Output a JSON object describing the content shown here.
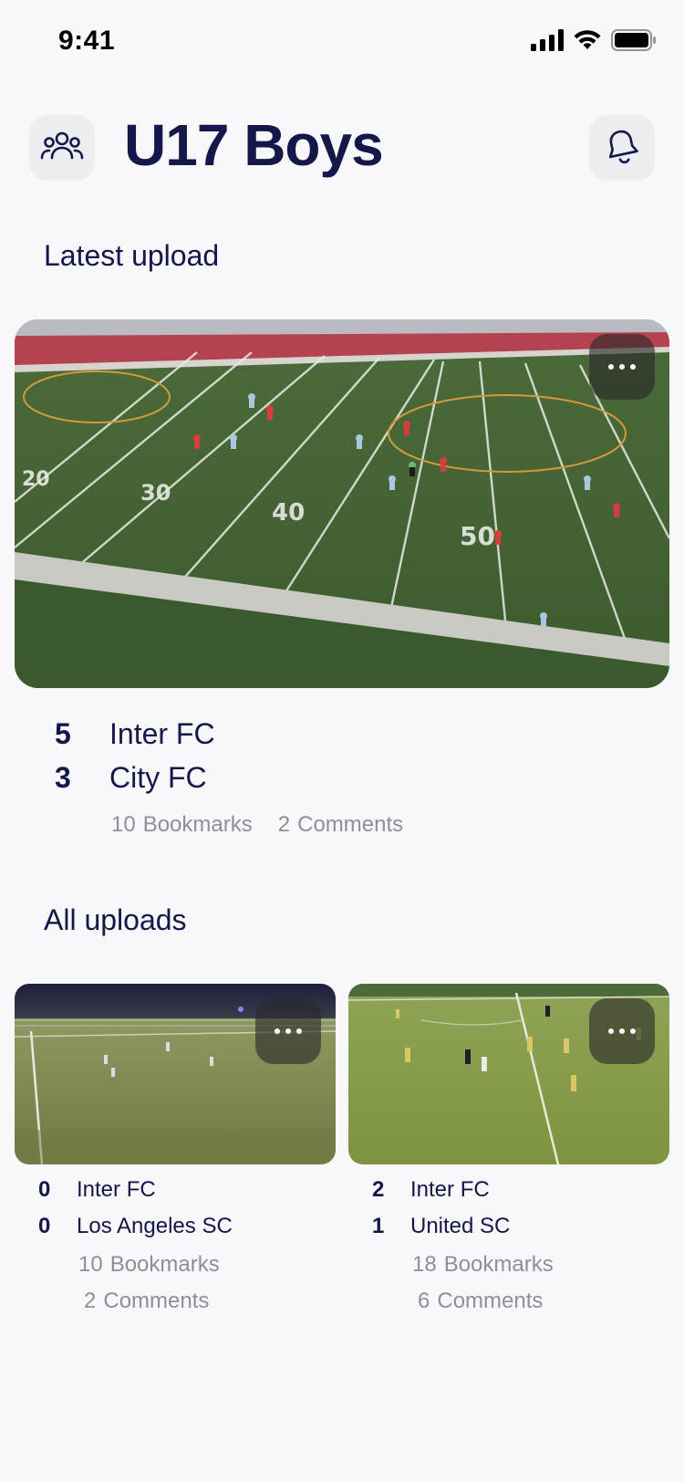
{
  "status_bar": {
    "time": "9:41",
    "icons": [
      "cellular-signal-icon",
      "wifi-icon",
      "battery-icon"
    ]
  },
  "header": {
    "title": "U17 Boys",
    "left_icon": "team-icon",
    "right_icon": "bell-icon"
  },
  "latest_upload": {
    "section_title": "Latest upload",
    "more_icon": "more-dots-icon",
    "home_score": "5",
    "home_team": "Inter FC",
    "away_score": "3",
    "away_team": "City FC",
    "bookmarks_count": "10",
    "bookmarks_label": "Bookmarks",
    "comments_count": "2",
    "comments_label": "Comments"
  },
  "all_uploads": {
    "section_title": "All uploads",
    "items": [
      {
        "home_score": "0",
        "home_team": "Inter FC",
        "away_score": "0",
        "away_team": "Los Angeles SC",
        "bookmarks_count": "10",
        "bookmarks_label": "Bookmarks",
        "comments_count": "2",
        "comments_label": "Comments"
      },
      {
        "home_score": "2",
        "home_team": "Inter FC",
        "away_score": "1",
        "away_team": "United SC",
        "bookmarks_count": "18",
        "bookmarks_label": "Bookmarks",
        "comments_count": "6",
        "comments_label": "Comments"
      }
    ]
  },
  "colors": {
    "background": "#f8f8fb",
    "primary_text": "#14174a",
    "secondary_text": "#8d8e9c",
    "icon_button_bg": "#ececf1"
  }
}
